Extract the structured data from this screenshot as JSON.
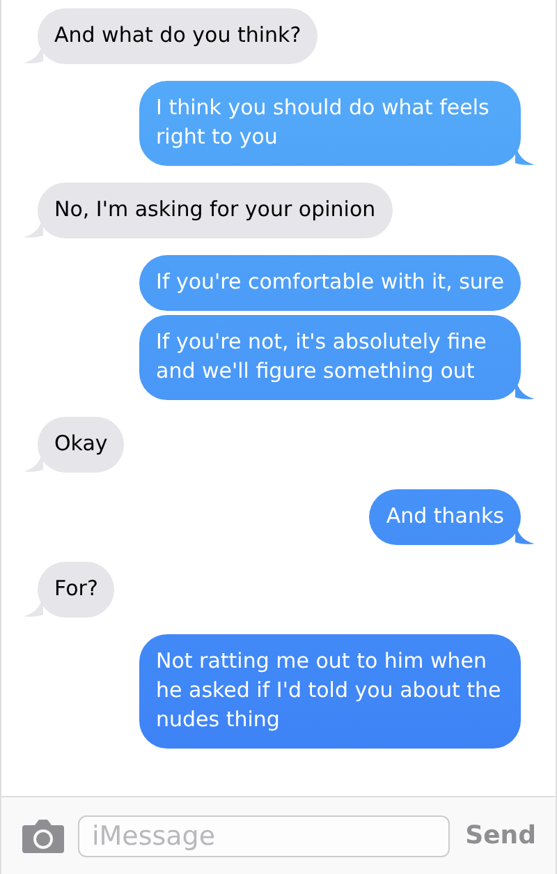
{
  "messages": [
    {
      "kind": "incoming",
      "text": "And what do you think?",
      "tail": true
    },
    {
      "kind": "outgoing",
      "text": "I think you should do what feels right to you",
      "tail": true
    },
    {
      "kind": "incoming",
      "text": "No, I'm asking for your opinion",
      "tail": true
    },
    {
      "kind": "outgoing",
      "text": "If you're comfortable with it, sure",
      "tail": false
    },
    {
      "kind": "outgoing",
      "text": "If you're not, it's absolutely fine and we'll figure something out",
      "tail": true
    },
    {
      "kind": "incoming",
      "text": "Okay",
      "tail": true
    },
    {
      "kind": "outgoing",
      "text": "And thanks",
      "tail": true
    },
    {
      "kind": "incoming",
      "text": "For?",
      "tail": true
    },
    {
      "kind": "outgoing",
      "text": "Not ratting me out to him when he asked if I'd told you about the nudes thing",
      "tail": false
    }
  ],
  "composer": {
    "placeholder": "iMessage",
    "send_label": "Send"
  }
}
